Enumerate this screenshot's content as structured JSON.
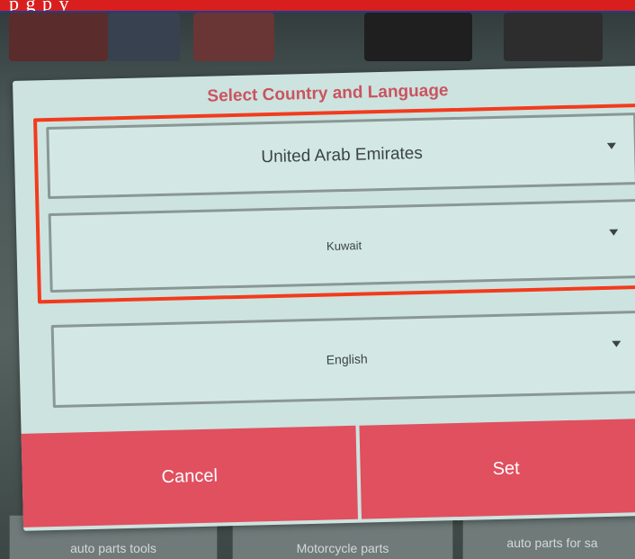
{
  "top_strip": {
    "text": "p                                     g                      p y"
  },
  "dialog": {
    "title": "Select Country and Language",
    "country_select": {
      "value": "United Arab Emirates"
    },
    "region_select": {
      "value": "Kuwait"
    },
    "language_select": {
      "value": "English"
    },
    "cancel_label": "Cancel",
    "set_label": "Set"
  },
  "background_tiles": [
    {
      "label": "auto parts tools"
    },
    {
      "label": "Motorcycle parts"
    },
    {
      "label": "auto parts for sa"
    }
  ],
  "colors": {
    "dialog_bg": "#cde3e0",
    "title": "#c9545e",
    "button_bg": "#e0505f",
    "highlight": "#f23b1d"
  },
  "icons": {
    "dropdown": "triangle-down"
  }
}
